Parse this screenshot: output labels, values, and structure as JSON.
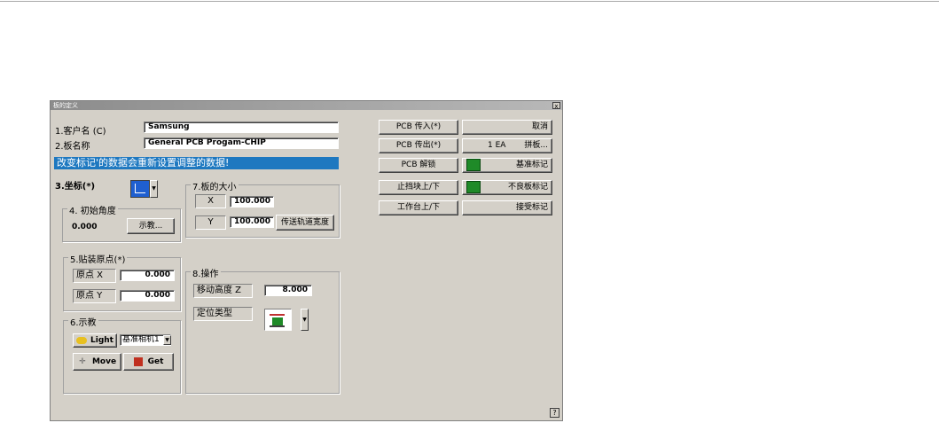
{
  "window": {
    "title": "板的定义",
    "close_label": "x",
    "help_label": "?"
  },
  "customer": {
    "label": "1.客户名 (C)",
    "value": "Samsung"
  },
  "board_name": {
    "label": "2.板名称",
    "value": "General PCB Progam-CHIP"
  },
  "banner_text": "改变标记'的数据会重新设置调整的数据!",
  "coordinate": {
    "label": "3.坐标(*)",
    "icon": "coordinate-system-icon"
  },
  "initial_angle": {
    "title": "4. 初始角度",
    "value": "0.000",
    "teach_button": "示教..."
  },
  "board_size": {
    "title": "7.板的大小",
    "x_label": "X",
    "x_value": "100.000",
    "y_label": "Y",
    "y_value": "100.000",
    "conveyor_button": "传送轨道宽度"
  },
  "mount_origin": {
    "title": "5.贴装原点(*)",
    "x_label": "原点 X",
    "x_value": "0.000",
    "y_label": "原点 Y",
    "y_value": "0.000"
  },
  "operation": {
    "title": "8.操作",
    "move_height_label": "移动高度 Z",
    "move_height_value": "8.000",
    "locate_type_label": "定位类型",
    "locate_icon": "pcb-locate-icon"
  },
  "teach": {
    "title": "6.示教",
    "light_button": "Light",
    "camera_select": "基准相机1",
    "move_button": "Move",
    "get_button": "Get"
  },
  "actions": {
    "pcb_in": "PCB 传入(*)",
    "pcb_out": "PCB 传出(*)",
    "pcb_unlock": "PCB 解锁",
    "stopper": "止挡块上/下",
    "table": "工作台上/下",
    "cancel": "取消",
    "array_count": "1 EA",
    "array_button": "拼板...",
    "fiducial": "基准标记",
    "bad_mark": "不良板标记",
    "accept_mark": "接受标记"
  },
  "colors": {
    "banner": "#1e78c0",
    "indicator_green": "#1f8a28",
    "dialog_bg": "#d4d0c8"
  }
}
